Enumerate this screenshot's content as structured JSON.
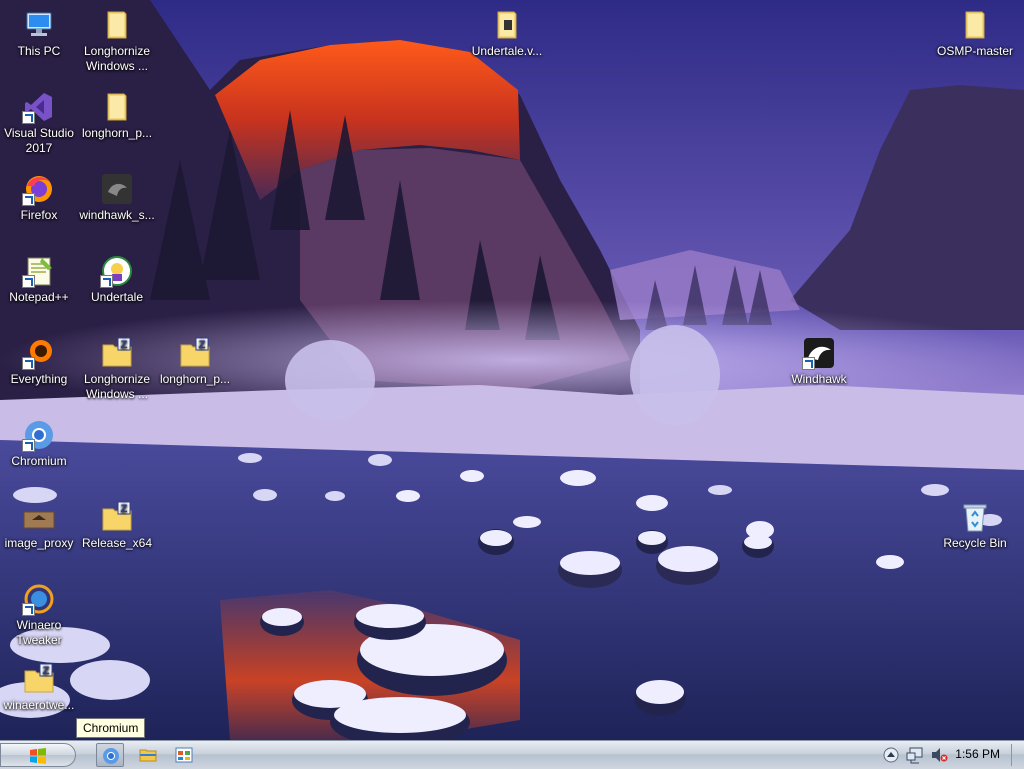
{
  "desktop": {
    "icons": [
      {
        "label": "This PC",
        "icon": "computer-icon"
      },
      {
        "label": "Longhornize Windows ...",
        "icon": "folder-icon"
      },
      {
        "label": "Visual Studio 2017",
        "icon": "visual-studio-icon"
      },
      {
        "label": "longhorn_p...",
        "icon": "folder-icon"
      },
      {
        "label": "Firefox",
        "icon": "firefox-icon"
      },
      {
        "label": "windhawk_s...",
        "icon": "image-file-icon"
      },
      {
        "label": "Notepad++",
        "icon": "notepad-plus-plus-icon"
      },
      {
        "label": "Undertale",
        "icon": "undertale-icon"
      },
      {
        "label": "Everything",
        "icon": "everything-search-icon"
      },
      {
        "label": "Longhornize Windows ...",
        "icon": "zip-folder-icon"
      },
      {
        "label": "longhorn_p...",
        "icon": "zip-folder-icon"
      },
      {
        "label": "Chromium",
        "icon": "chromium-icon"
      },
      {
        "label": "image_proxy",
        "icon": "image-file-icon"
      },
      {
        "label": "Release_x64",
        "icon": "zip-folder-icon"
      },
      {
        "label": "Winaero Tweaker",
        "icon": "winaero-tweaker-icon"
      },
      {
        "label": "winaerotwe...",
        "icon": "zip-folder-icon"
      },
      {
        "label": "Undertale.v...",
        "icon": "folder-icon"
      },
      {
        "label": "OSMP-master",
        "icon": "folder-icon"
      },
      {
        "label": "Windhawk",
        "icon": "windhawk-icon"
      },
      {
        "label": "Recycle Bin",
        "icon": "recycle-bin-icon"
      }
    ]
  },
  "tooltip": {
    "text": "Chromium"
  },
  "taskbar": {
    "start_icon": "windows-logo-icon",
    "pinned": [
      {
        "name": "Chromium",
        "icon": "chromium-icon",
        "active": true
      },
      {
        "name": "File Explorer",
        "icon": "file-explorer-icon",
        "active": false
      },
      {
        "name": "Control Panel",
        "icon": "control-panel-icon",
        "active": false
      }
    ],
    "tray": {
      "icons": [
        "show-hidden-icons-icon",
        "network-icon",
        "volume-muted-icon"
      ],
      "clock": "1:56 PM"
    }
  },
  "colors": {
    "sky": "#3b3a8e",
    "cliff_glow": "#e8401c",
    "water": "#2a2f6e",
    "snow": "#e6e6ff"
  }
}
